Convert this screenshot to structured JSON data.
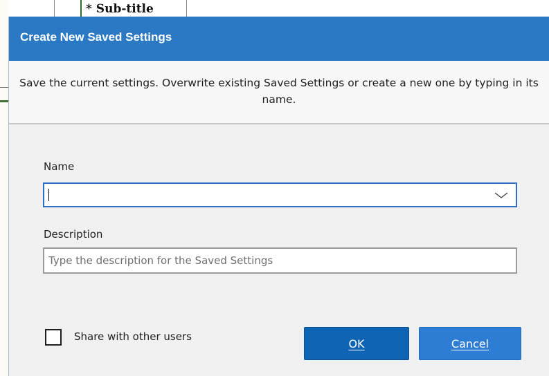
{
  "background": {
    "subtitle_text": "* Sub-title"
  },
  "dialog": {
    "title": "Create New Saved Settings",
    "instructions": "Save the current settings.  Overwrite existing Saved Settings or create a new one by typing in its name.",
    "name_label": "Name",
    "name_value": "",
    "name_dropdown_icon": "chevron-down-icon",
    "description_label": "Description",
    "description_placeholder": "Type the description for the Saved Settings",
    "description_value": "",
    "share_label": "Share with other users",
    "share_checked": false,
    "ok_label": "OK",
    "cancel_label": "Cancel"
  },
  "colors": {
    "titlebar": "#2b78c5",
    "ok_button": "#0f65b3",
    "cancel_button": "#2c7dd3",
    "focus_border": "#2a6fc4"
  }
}
